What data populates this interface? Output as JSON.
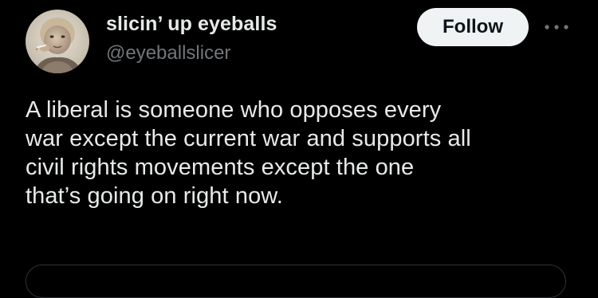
{
  "tweet": {
    "author": {
      "display_name": "slicin’ up eyeballs",
      "handle": "@eyeballslicer",
      "avatar_icon": "avatar-photo"
    },
    "follow_label": "Follow",
    "more_icon": "more-options-icon",
    "text": "A liberal is someone who opposes every\nwar except the current war and supports all\ncivil rights movements except the one\nthat’s going on right now."
  },
  "colors": {
    "background": "#000000",
    "text_primary": "#e7e9ea",
    "text_secondary": "#71767b",
    "follow_bg": "#eff3f4",
    "follow_text": "#0f1419",
    "border": "#2f3336"
  }
}
